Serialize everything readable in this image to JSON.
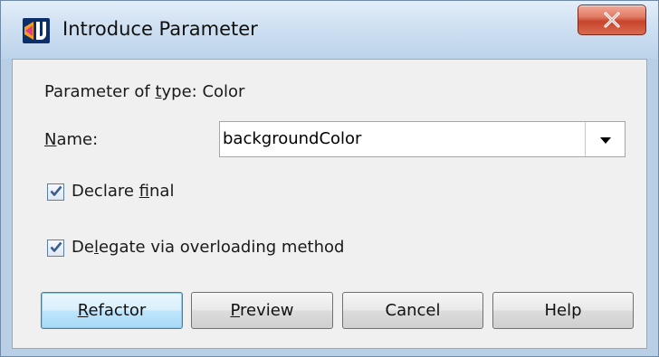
{
  "window": {
    "title": "Introduce Parameter"
  },
  "form": {
    "param_type_prefix": "Parameter of ",
    "param_type_mnemonic": "t",
    "param_type_rest": "ype: Color",
    "name_mnemonic": "N",
    "name_rest": "ame:",
    "name_value": "backgroundColor",
    "declare_final_prefix": "Declare ",
    "declare_final_mnemonic": "f",
    "declare_final_rest": "inal",
    "declare_final_checked": true,
    "delegate_prefix": "De",
    "delegate_mnemonic": "l",
    "delegate_rest": "egate via overloading method",
    "delegate_checked": true
  },
  "buttons": {
    "refactor_mnemonic": "R",
    "refactor_rest": "efactor",
    "preview_mnemonic": "P",
    "preview_rest": "review",
    "cancel_label": "Cancel",
    "help_label": "Help"
  },
  "colors": {
    "accent": "#3c7fb1",
    "close": "#c7452c",
    "check": "#3a5f8f"
  },
  "icons": {
    "app": "intellij-idea-icon",
    "close": "close-icon",
    "dropdown": "chevron-down-icon",
    "check": "check-icon"
  }
}
